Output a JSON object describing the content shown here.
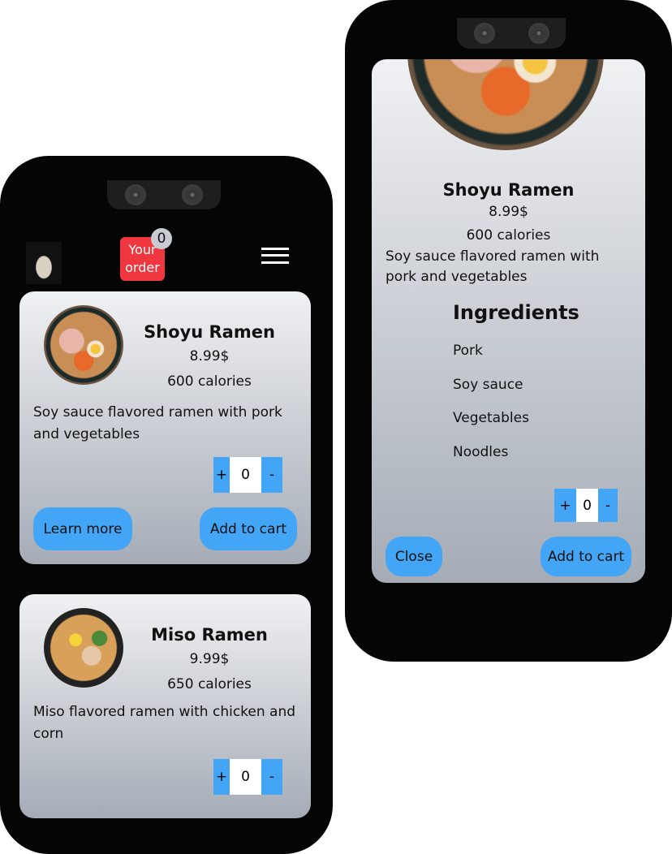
{
  "left_phone": {
    "header": {
      "order_label": "Your order",
      "order_count": "0",
      "logo": "chef-logo",
      "menu_icon": "hamburger-menu-icon",
      "order_color": "#f0373f"
    },
    "cards": [
      {
        "title": "Shoyu Ramen",
        "price": "8.99$",
        "calories": "600 calories",
        "description": "Soy sauce flavored ramen with pork and vegetables",
        "plus": "+",
        "qty": "0",
        "minus": "-",
        "learn_more": "Learn more",
        "add_to_cart": "Add to cart"
      },
      {
        "title": "Miso Ramen",
        "price": "9.99$",
        "calories": "650 calories",
        "description": "Miso flavored ramen with chicken and corn",
        "plus": "+",
        "qty": "0",
        "minus": "-"
      }
    ]
  },
  "right_phone": {
    "title": "Shoyu Ramen",
    "price": "8.99$",
    "calories": "600 calories",
    "description": "Soy sauce flavored ramen with pork and vegetables",
    "ingredients_heading": "Ingredients",
    "ingredients": [
      "Pork",
      "Soy sauce",
      "Vegetables",
      "Noodles"
    ],
    "plus": "+",
    "qty": "0",
    "minus": "-",
    "close": "Close",
    "add_to_cart": "Add to cart"
  },
  "accent_color": "#42a5f5"
}
